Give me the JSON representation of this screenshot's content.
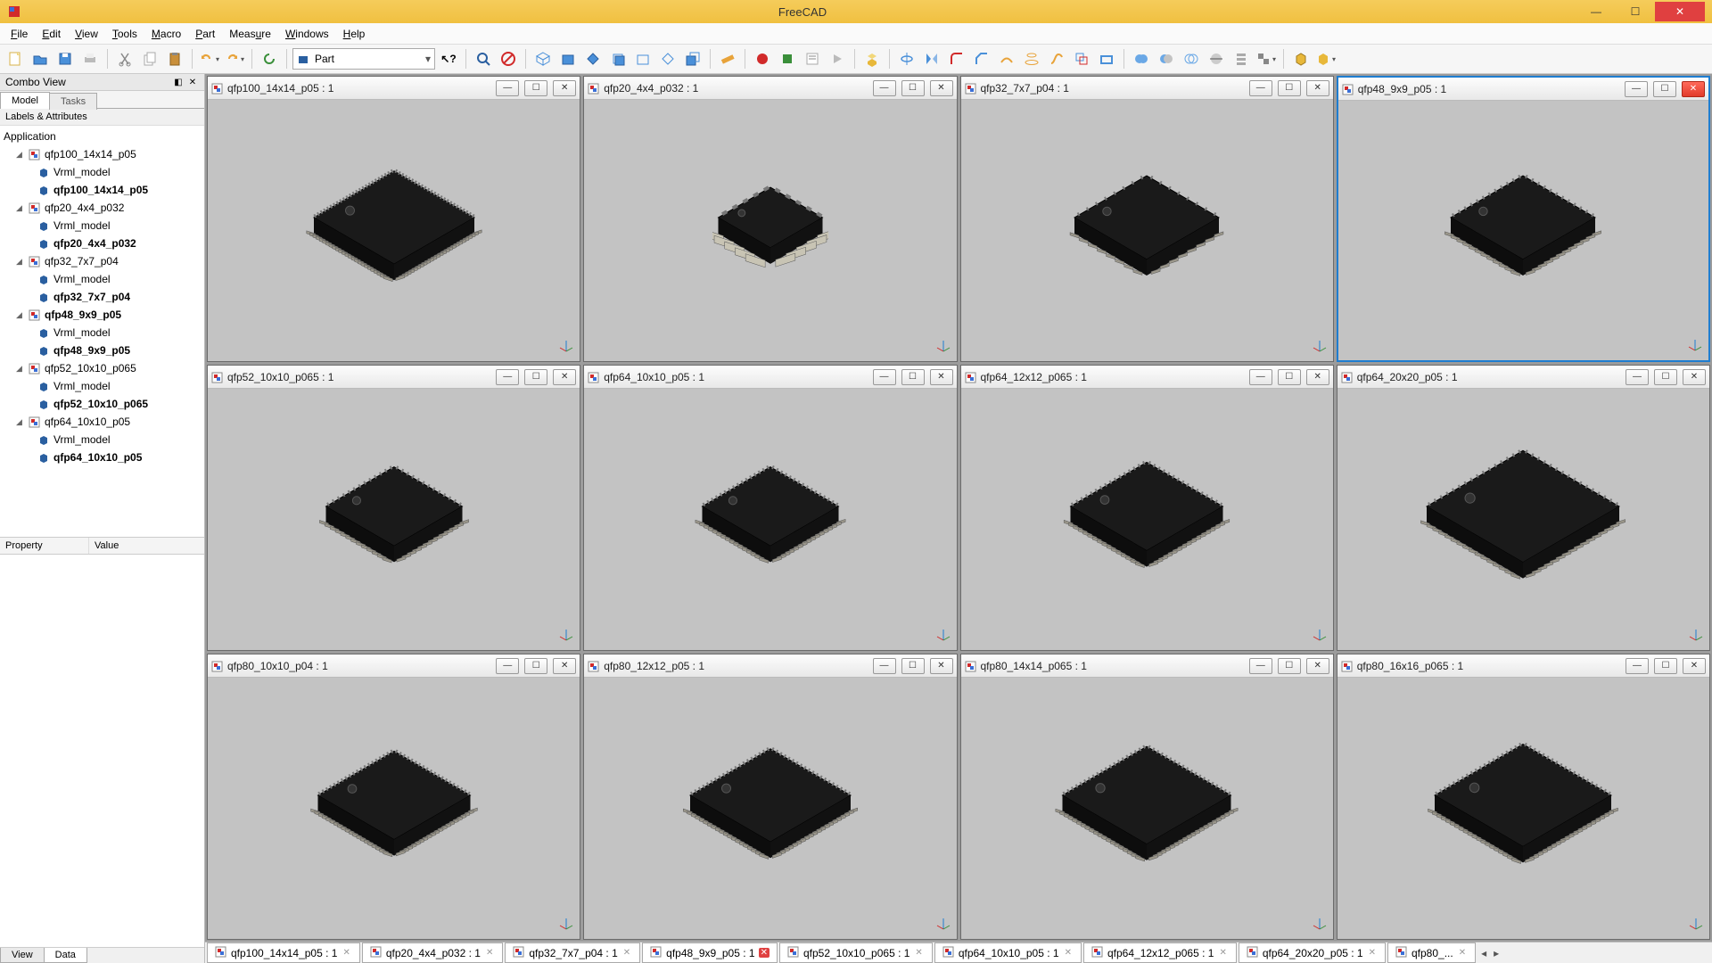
{
  "app": {
    "title": "FreeCAD"
  },
  "menus": [
    "File",
    "Edit",
    "View",
    "Tools",
    "Macro",
    "Part",
    "Measure",
    "Windows",
    "Help"
  ],
  "workbench": "Part",
  "combo": {
    "panel_title": "Combo View",
    "tabs": [
      "Model",
      "Tasks"
    ],
    "tree_header": "Labels & Attributes",
    "root": "Application",
    "prop_headers": [
      "Property",
      "Value"
    ],
    "bottom_tabs": [
      "View",
      "Data"
    ]
  },
  "tree": [
    {
      "doc": "qfp100_14x14_p05",
      "children": [
        "Vrml_model",
        "qfp100_14x14_p05"
      ]
    },
    {
      "doc": "qfp20_4x4_p032",
      "children": [
        "Vrml_model",
        "qfp20_4x4_p032"
      ]
    },
    {
      "doc": "qfp32_7x7_p04",
      "children": [
        "Vrml_model",
        "qfp32_7x7_p04"
      ]
    },
    {
      "doc": "qfp48_9x9_p05",
      "children": [
        "Vrml_model",
        "qfp48_9x9_p05"
      ],
      "bold_doc": true
    },
    {
      "doc": "qfp52_10x10_p065",
      "children": [
        "Vrml_model",
        "qfp52_10x10_p065"
      ]
    },
    {
      "doc": "qfp64_10x10_p05",
      "children": [
        "Vrml_model",
        "qfp64_10x10_p05"
      ]
    }
  ],
  "mdi": [
    {
      "title": "qfp100_14x14_p05 : 1",
      "pins": 25,
      "body": 200,
      "active": false
    },
    {
      "title": "qfp20_4x4_p032 : 1",
      "pins": 5,
      "body": 130,
      "active": false,
      "big_leads": true
    },
    {
      "title": "qfp32_7x7_p04 : 1",
      "pins": 8,
      "body": 180,
      "active": false
    },
    {
      "title": "qfp48_9x9_p05 : 1",
      "pins": 12,
      "body": 180,
      "active": true
    },
    {
      "title": "qfp52_10x10_p065 : 1",
      "pins": 13,
      "body": 170,
      "active": false
    },
    {
      "title": "qfp64_10x10_p05 : 1",
      "pins": 16,
      "body": 170,
      "active": false
    },
    {
      "title": "qfp64_12x12_p065 : 1",
      "pins": 16,
      "body": 190,
      "active": false
    },
    {
      "title": "qfp64_20x20_p05 : 1",
      "pins": 16,
      "body": 240,
      "active": false
    },
    {
      "title": "qfp80_10x10_p04 : 1",
      "pins": 20,
      "body": 190,
      "active": false
    },
    {
      "title": "qfp80_12x12_p05 : 1",
      "pins": 20,
      "body": 200,
      "active": false
    },
    {
      "title": "qfp80_14x14_p065 : 1",
      "pins": 20,
      "body": 210,
      "active": false
    },
    {
      "title": "qfp80_16x16_p065 : 1",
      "pins": 20,
      "body": 220,
      "active": false
    }
  ],
  "doc_tabs": [
    {
      "label": "qfp100_14x14_p05 : 1"
    },
    {
      "label": "qfp20_4x4_p032 : 1"
    },
    {
      "label": "qfp32_7x7_p04 : 1"
    },
    {
      "label": "qfp48_9x9_p05 : 1",
      "active": true
    },
    {
      "label": "qfp52_10x10_p065 : 1"
    },
    {
      "label": "qfp64_10x10_p05 : 1"
    },
    {
      "label": "qfp64_12x12_p065 : 1"
    },
    {
      "label": "qfp64_20x20_p05 : 1"
    },
    {
      "label": "qfp80_..."
    }
  ]
}
